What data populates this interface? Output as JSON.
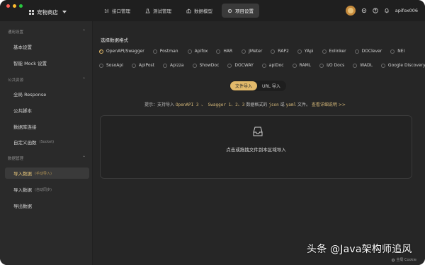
{
  "window": {
    "project_name": "宠物商店",
    "tabs": [
      {
        "label": "接口管理",
        "icon": "api-icon",
        "active": false
      },
      {
        "label": "测试管理",
        "icon": "flask-icon",
        "active": false
      },
      {
        "label": "数据模型",
        "icon": "model-icon",
        "active": false
      },
      {
        "label": "项目设置",
        "icon": "gear-icon",
        "active": true
      }
    ],
    "username": "apifox006"
  },
  "sidebar": {
    "sections": [
      {
        "label": "通用设置",
        "items": [
          {
            "label": "基本设置",
            "sub": ""
          },
          {
            "label": "智能 Mock 设置",
            "sub": ""
          }
        ]
      },
      {
        "label": "公共资源",
        "items": [
          {
            "label": "全局 Response",
            "sub": ""
          },
          {
            "label": "公共脚本",
            "sub": ""
          },
          {
            "label": "数据库连接",
            "sub": ""
          },
          {
            "label": "自定义函数",
            "sub": "(Socket)"
          }
        ]
      },
      {
        "label": "数据管理",
        "items": [
          {
            "label": "导入数据",
            "sub": "(手动导入)",
            "active": true
          },
          {
            "label": "导入数据",
            "sub": "(自动同步)"
          },
          {
            "label": "导出数据",
            "sub": ""
          }
        ]
      }
    ]
  },
  "main": {
    "heading": "选择数据格式",
    "formats_row1": [
      "OpenAPI/Swagger",
      "Postman",
      "Apifox",
      "HAR",
      "JMeter",
      "RAP2",
      "YApi",
      "Eolinker",
      "DOClever",
      "NEI"
    ],
    "formats_row2": [
      "SosoApi",
      "ApiPost",
      "Apizza",
      "ShowDoc",
      "DOCWAY",
      "apiDoc",
      "RAML",
      "I/O Docs",
      "WADL",
      "Google Discovery"
    ],
    "selected_format": "OpenAPI/Swagger",
    "import_modes": [
      "文件导入",
      "URL 导入"
    ],
    "selected_mode": "文件导入",
    "hint": {
      "prefix": "提示：支持导入",
      "code1": "OpenAPI 3 、 Swagger 1、2、3",
      "mid": "数据格式的",
      "code2": "json",
      "or": "或",
      "code3": "yaml",
      "suffix": "文件。",
      "link": "查看详细说明 >>"
    },
    "drop_text": "点击或拖拽文件到本区域导入"
  },
  "watermark": "头条 @Java架构师追风",
  "cookie_text": "全局 Cookie",
  "colors": {
    "accent": "#e1b868",
    "background": "#262626",
    "sidebar": "#2a2a2a",
    "topbar": "#1f1f1f"
  }
}
